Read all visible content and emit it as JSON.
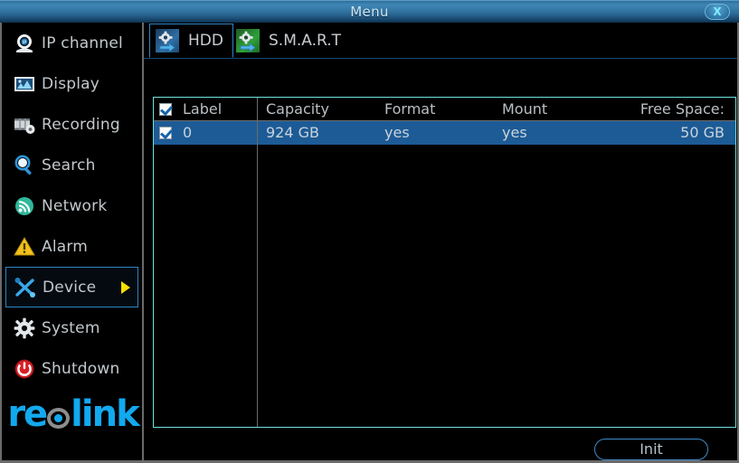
{
  "window": {
    "title": "Menu",
    "close_label": "X"
  },
  "sidebar": {
    "items": [
      {
        "label": "IP channel",
        "icon": "camera-icon",
        "selected": false
      },
      {
        "label": "Display",
        "icon": "display-icon",
        "selected": false
      },
      {
        "label": "Recording",
        "icon": "recording-icon",
        "selected": false
      },
      {
        "label": "Search",
        "icon": "magnifier-icon",
        "selected": false
      },
      {
        "label": "Network",
        "icon": "network-signal-icon",
        "selected": false
      },
      {
        "label": "Alarm",
        "icon": "warning-triangle-icon",
        "selected": false
      },
      {
        "label": "Device",
        "icon": "tools-icon",
        "selected": true
      },
      {
        "label": "System",
        "icon": "gear-icon",
        "selected": false
      },
      {
        "label": "Shutdown",
        "icon": "power-icon",
        "selected": false
      }
    ],
    "brand": {
      "prefix": "re",
      "suffix": "link"
    }
  },
  "tabs": [
    {
      "label": "HDD",
      "icon": "hdd-gear-icon",
      "active": true,
      "icon_color": "blue"
    },
    {
      "label": "S.M.A.R.T",
      "icon": "smart-gear-icon",
      "active": false,
      "icon_color": "green"
    }
  ],
  "table": {
    "headers": {
      "label": "Label",
      "capacity": "Capacity",
      "format": "Format",
      "mount": "Mount",
      "free_space": "Free Space:"
    },
    "rows": [
      {
        "checked": true,
        "label": "0",
        "capacity": "924 GB",
        "format": "yes",
        "mount": "yes",
        "free_space": "50 GB",
        "selected": true
      }
    ],
    "select_all_checked": true
  },
  "footer": {
    "init_label": "Init"
  },
  "colors": {
    "accent": "#12a9ef",
    "table_border": "#6fe3e0",
    "row_selected": "#1d5b96",
    "arrow_yellow": "#f5e000",
    "titlebar_top": "#3f86b4"
  }
}
